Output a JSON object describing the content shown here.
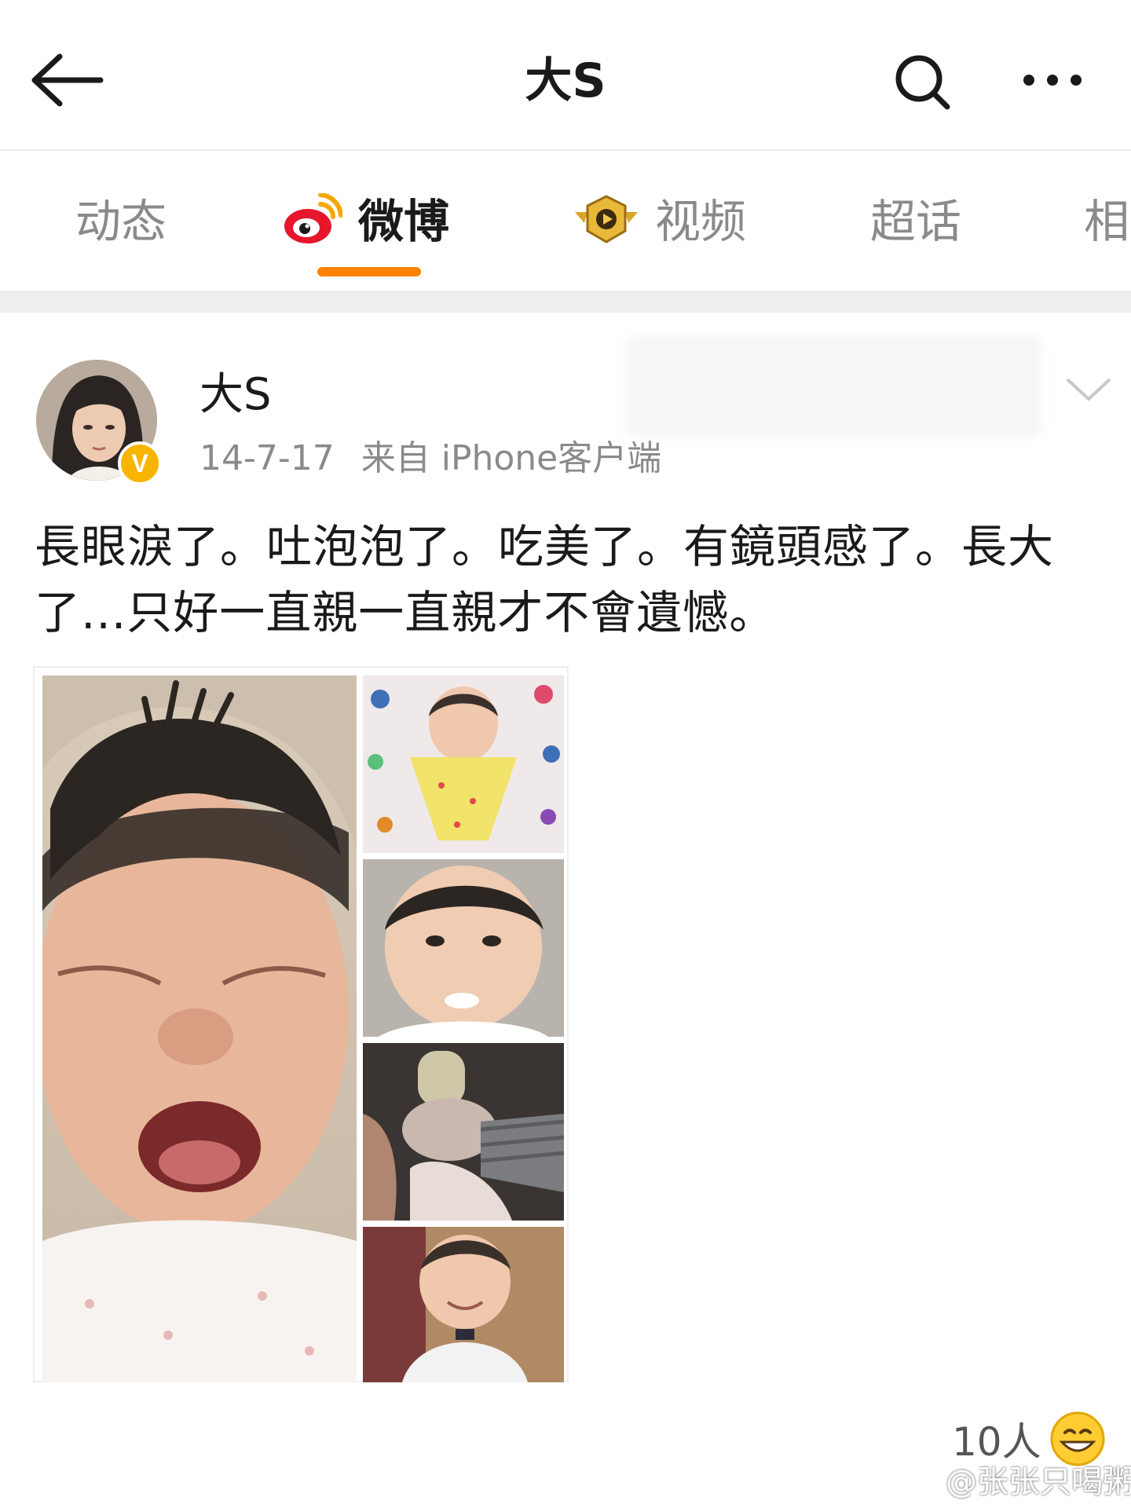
{
  "header": {
    "title": "大S"
  },
  "tabs": [
    {
      "label": "动态",
      "active": false
    },
    {
      "label": "微博",
      "active": true,
      "icon": "weibo-logo-icon"
    },
    {
      "label": "视频",
      "active": false,
      "icon": "video-badge-icon"
    },
    {
      "label": "超话",
      "active": false
    },
    {
      "label": "相",
      "active": false
    }
  ],
  "post": {
    "author": "大S",
    "verified_badge": "V",
    "date": "14-7-17",
    "source": "来自 iPhone客户端",
    "text": "長眼淚了。吐泡泡了。吃美了。有鏡頭感了。長大了...只好一直親一直親才不會遺憾。",
    "images": [
      {
        "name": "crying-baby-photo"
      },
      {
        "name": "baby-in-bib-photo"
      },
      {
        "name": "baby-bubbles-photo"
      },
      {
        "name": "baby-bottle-photo"
      },
      {
        "name": "smiling-baby-photo"
      }
    ]
  },
  "footer": {
    "likes": "10人",
    "watermark": "@张张只喝粥"
  },
  "colors": {
    "accent": "#ff8200",
    "verified": "#f7b500",
    "muted_text": "#8a8a8a"
  }
}
